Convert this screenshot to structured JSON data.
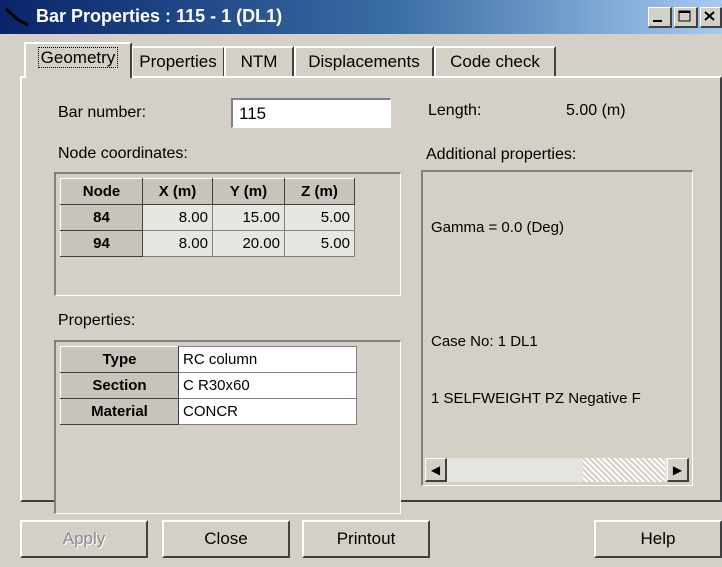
{
  "window": {
    "title": "Bar Properties : 115 - 1 (DL1)"
  },
  "tabs": [
    {
      "label": "Geometry"
    },
    {
      "label": "Properties"
    },
    {
      "label": "NTM"
    },
    {
      "label": "Displacements"
    },
    {
      "label": "Code check"
    }
  ],
  "geometry": {
    "bar_number_label": "Bar number:",
    "bar_number_value": "115",
    "length_label": "Length:",
    "length_value": "5.00 (m)",
    "node_coords_label": "Node coordinates:",
    "additional_label": "Additional properties:",
    "properties_label": "Properties:",
    "node_table": {
      "headers": [
        "Node",
        "X (m)",
        "Y (m)",
        "Z (m)"
      ],
      "rows": [
        [
          "84",
          "8.00",
          "15.00",
          "5.00"
        ],
        [
          "94",
          "8.00",
          "20.00",
          "5.00"
        ]
      ]
    },
    "props_table": {
      "rows": [
        [
          "Type",
          "RC column"
        ],
        [
          "Section",
          "C R30x60"
        ],
        [
          "Material",
          "CONCR"
        ]
      ]
    },
    "additional_lines": [
      "Gamma = 0.0 (Deg)",
      "",
      "Case No: 1 DL1",
      "1 SELFWEIGHT PZ Negative F"
    ]
  },
  "buttons": {
    "apply": "Apply",
    "close": "Close",
    "printout": "Printout",
    "help": "Help"
  },
  "colors": {
    "titlebar_start": "#0a246a",
    "titlebar_end": "#a6caf0",
    "face": "#d4d0c8"
  }
}
